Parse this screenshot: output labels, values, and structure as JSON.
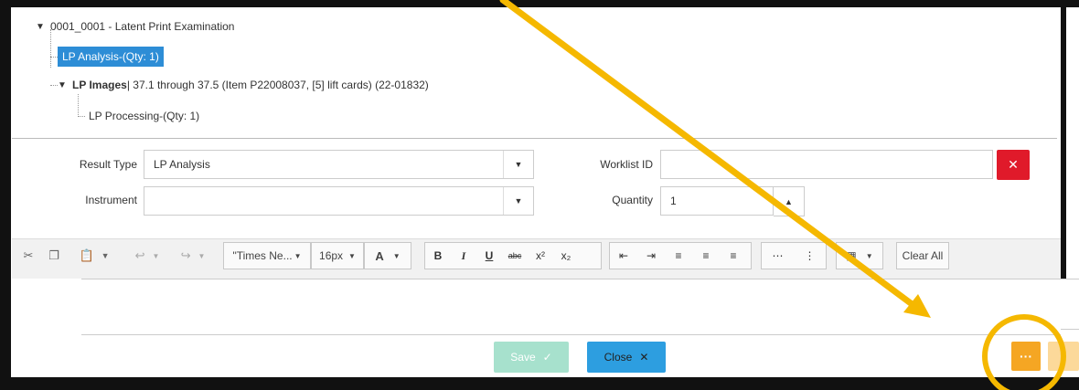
{
  "tree": {
    "root": "0001_0001 - Latent Print Examination",
    "selected": "LP Analysis-(Qty: 1)",
    "images_bold": "LP Images",
    "images_rest": " | 37.1 through 37.5 (Item P22008037, [5] lift cards) (22-01832)",
    "processing": "LP Processing-(Qty: 1)"
  },
  "form": {
    "result_type_label": "Result Type",
    "result_type_value": "LP Analysis",
    "instrument_label": "Instrument",
    "instrument_value": "",
    "worklist_label": "Worklist ID",
    "worklist_value": "",
    "quantity_label": "Quantity",
    "quantity_value": "1"
  },
  "toolbar": {
    "font_family": "\"Times Ne...",
    "font_size": "16px",
    "font_color": "A",
    "bold": "B",
    "italic": "I",
    "underline": "U",
    "strike": "abc",
    "superscript": "x²",
    "subscript": "x₂",
    "clear_all": "Clear All"
  },
  "buttons": {
    "save": "Save",
    "close": "Close",
    "more": "···"
  },
  "colors": {
    "selected": "#2d8dd6",
    "clear": "#e01a2a",
    "save": "#a7e1cd",
    "close": "#2d9ee0",
    "more": "#f5a623",
    "annotation": "#f5b800"
  }
}
